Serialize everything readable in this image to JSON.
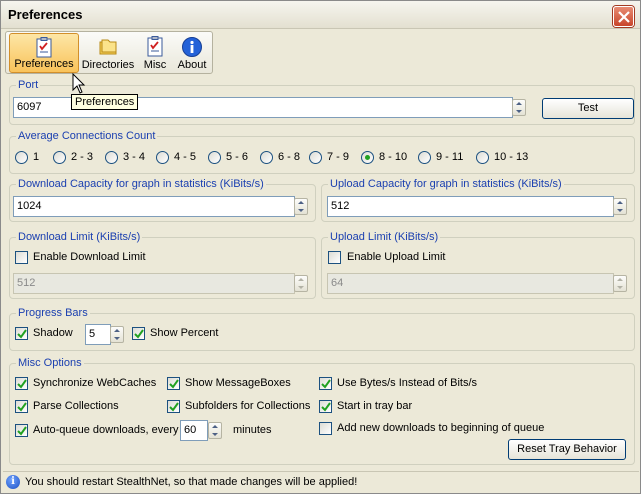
{
  "window": {
    "title": "Preferences"
  },
  "toolbar": {
    "items": [
      {
        "label": "Preferences",
        "icon": "checklist-icon"
      },
      {
        "label": "Directories",
        "icon": "folder-icon"
      },
      {
        "label": "Misc",
        "icon": "checklist-icon"
      },
      {
        "label": "About",
        "icon": "info-icon"
      }
    ],
    "active": "Preferences"
  },
  "tooltip": {
    "text": "Preferences"
  },
  "port": {
    "legend": "Port",
    "value": "6097",
    "test_label": "Test"
  },
  "connections": {
    "legend": "Average Connections Count",
    "options": [
      "1",
      "2 - 3",
      "3 - 4",
      "4 - 5",
      "5 - 6",
      "6 - 8",
      "7 - 9",
      "8 - 10",
      "9 - 11",
      "10 - 13"
    ],
    "selected": "8 - 10"
  },
  "download_capacity": {
    "legend": "Download Capacity for graph in statistics (KiBits/s)",
    "value": "1024"
  },
  "upload_capacity": {
    "legend": "Upload Capacity for graph in statistics (KiBits/s)",
    "value": "512"
  },
  "download_limit": {
    "legend": "Download Limit (KiBits/s)",
    "checkbox_label": "Enable Download Limit",
    "checked": false,
    "value": "512"
  },
  "upload_limit": {
    "legend": "Upload Limit (KiBits/s)",
    "checkbox_label": "Enable Upload Limit",
    "checked": false,
    "value": "64"
  },
  "progress_bars": {
    "legend": "Progress Bars",
    "shadow_label": "Shadow",
    "shadow_checked": true,
    "shadow_value": "5",
    "percent_label": "Show Percent",
    "percent_checked": true
  },
  "misc": {
    "legend": "Misc Options",
    "sync_webcaches": "Synchronize WebCaches",
    "parse_collections": "Parse Collections",
    "auto_queue": "Auto-queue downloads, every",
    "auto_queue_value": "60",
    "minutes": "minutes",
    "show_messageboxes": "Show MessageBoxes",
    "subfolders": "Subfolders for Collections",
    "bytes": "Use Bytes/s Instead of Bits/s",
    "tray": "Start in tray bar",
    "add_downloads": "Add new downloads to beginning of queue",
    "reset_tray": "Reset Tray Behavior"
  },
  "status": {
    "text": "You should restart StealthNet, so that made changes will be applied!"
  },
  "colors": {
    "legend_text": "#1a3fb0",
    "active_tab": "#f9c35a",
    "close_button": "#c8452a"
  }
}
